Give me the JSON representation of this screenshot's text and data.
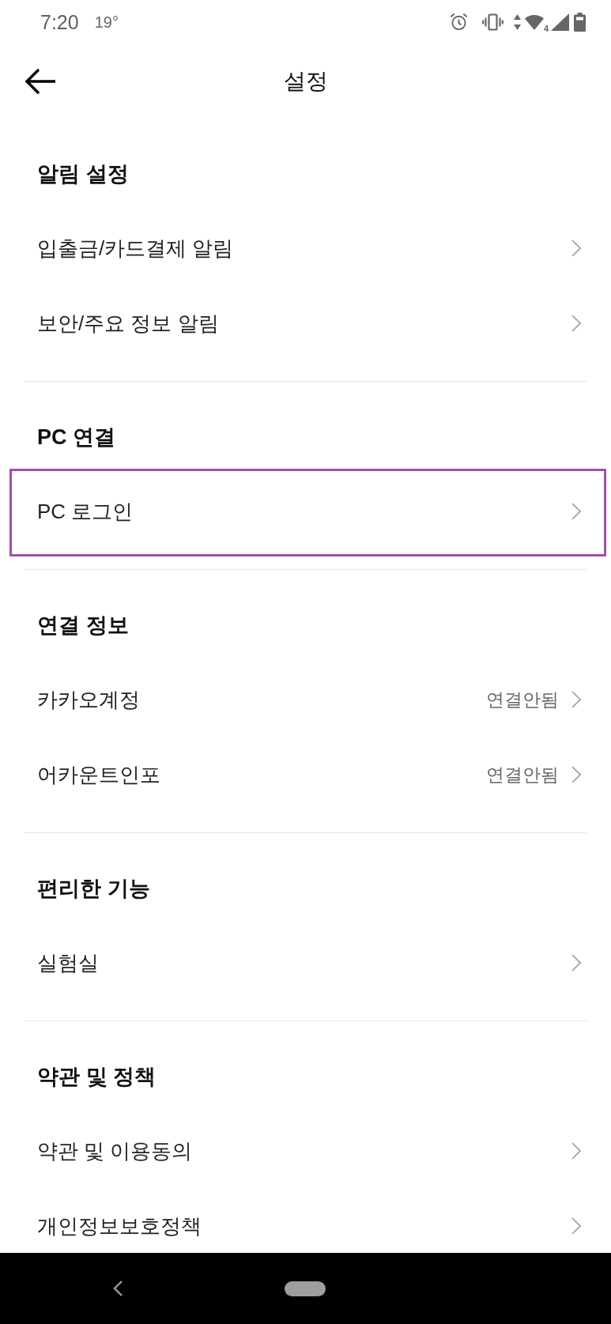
{
  "status_bar": {
    "time": "7:20",
    "temperature": "19°",
    "network_type": "4"
  },
  "header": {
    "title": "설정"
  },
  "sections": [
    {
      "title": "알림 설정",
      "items": [
        {
          "label": "입출금/카드결제 알림",
          "highlighted": false
        },
        {
          "label": "보안/주요 정보 알림",
          "highlighted": false
        }
      ]
    },
    {
      "title": "PC 연결",
      "items": [
        {
          "label": "PC 로그인",
          "highlighted": true
        }
      ]
    },
    {
      "title": "연결 정보",
      "items": [
        {
          "label": "카카오계정",
          "value": "연결안됨",
          "highlighted": false
        },
        {
          "label": "어카운트인포",
          "value": "연결안됨",
          "highlighted": false
        }
      ]
    },
    {
      "title": "편리한 기능",
      "items": [
        {
          "label": "실험실",
          "highlighted": false
        }
      ]
    },
    {
      "title": "약관 및 정책",
      "items": [
        {
          "label": "약관 및 이용동의",
          "highlighted": false
        },
        {
          "label": "개인정보보호정책",
          "highlighted": false
        }
      ]
    }
  ]
}
